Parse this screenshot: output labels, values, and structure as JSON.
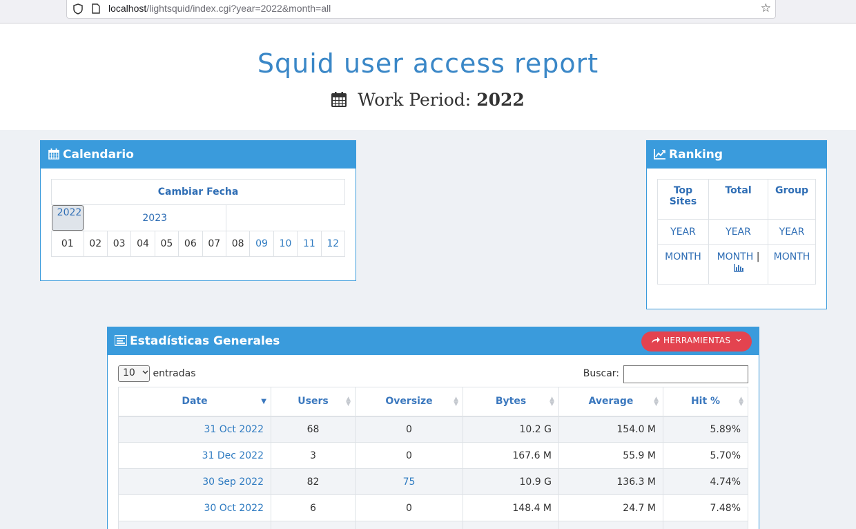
{
  "browser": {
    "url_host": "localhost",
    "url_rest": "/lightsquid/index.cgi?year=2022&month=all"
  },
  "header": {
    "title": "Squid user access report",
    "period_label": "Work Period:",
    "period_value": "2022"
  },
  "calendar": {
    "title": "Calendario",
    "change_date": "Cambiar Fecha",
    "years": [
      "2022",
      "2023"
    ],
    "months": [
      "01",
      "02",
      "03",
      "04",
      "05",
      "06",
      "07",
      "08",
      "09",
      "10",
      "11",
      "12"
    ]
  },
  "ranking": {
    "title": "Ranking",
    "col1_a": "Top",
    "col1_b": "Sites",
    "col2": "Total",
    "col3": "Group",
    "year": "YEAR",
    "month": "MONTH",
    "sep": "|"
  },
  "stats": {
    "title": "Estadísticas Generales",
    "tools_label": "HERRAMIENTAS",
    "page_size": "10",
    "entries_label": "entradas",
    "search_label": "Buscar:",
    "search_value": "",
    "columns": [
      "Date",
      "Users",
      "Oversize",
      "Bytes",
      "Average",
      "Hit %"
    ],
    "rows": [
      [
        "31 Oct 2022",
        "68",
        "0",
        "10.2 G",
        "154.0 M",
        "5.89%"
      ],
      [
        "31 Dec 2022",
        "3",
        "0",
        "167.6 M",
        "55.9 M",
        "5.70%"
      ],
      [
        "30 Sep 2022",
        "82",
        "75",
        "10.9 G",
        "136.3 M",
        "4.74%"
      ],
      [
        "30 Oct 2022",
        "6",
        "0",
        "148.4 M",
        "24.7 M",
        "7.48%"
      ]
    ]
  },
  "colors": {
    "accent": "#3a9bdc",
    "link": "#2f7bc1",
    "danger": "#e3434f",
    "title": "#3a87c7"
  }
}
